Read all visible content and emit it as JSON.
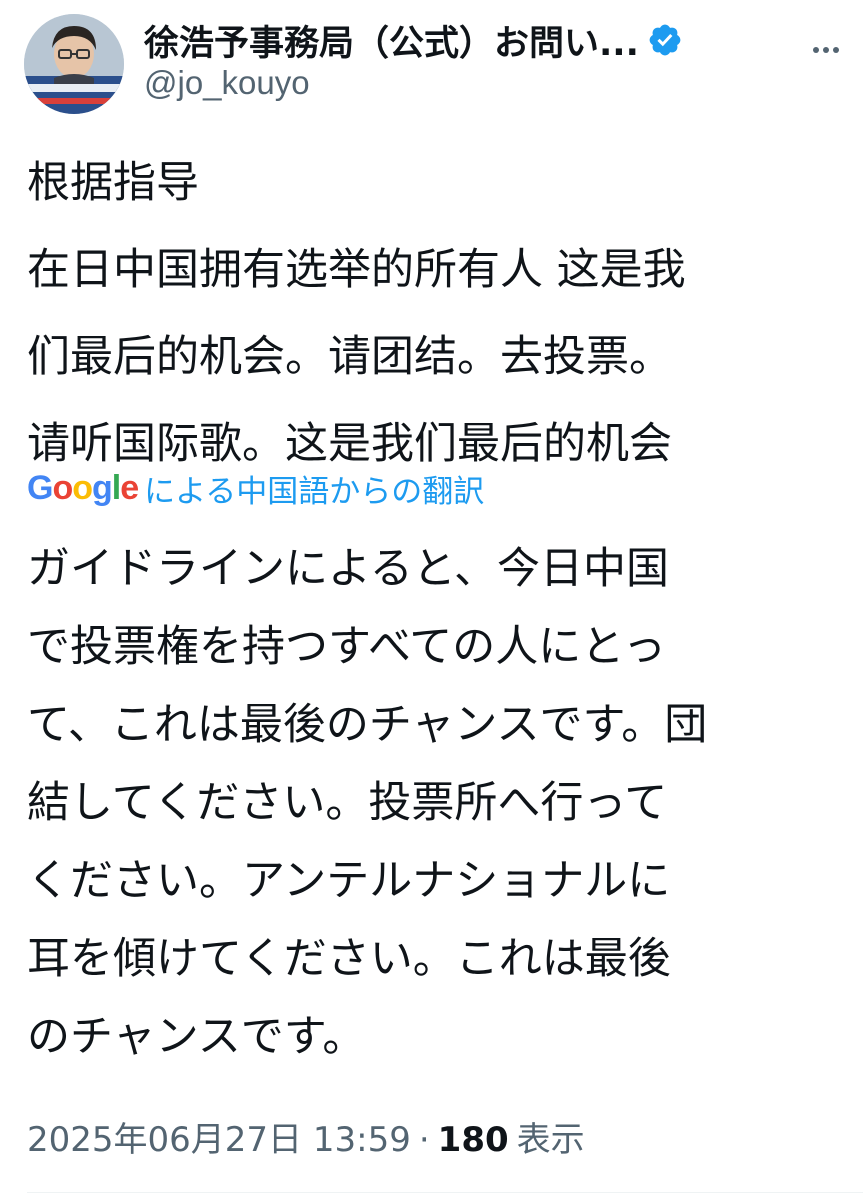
{
  "author": {
    "display_name": "徐浩予事務局（公式）お問い...",
    "handle": "@jo_kouyo",
    "verified": true,
    "verified_color": "#1d9bf0"
  },
  "tweet": {
    "original_text": "根据指导\n在日中国拥有选举的所有人  这是我\n们最后的机会。请团结。去投票。\n请听国际歌。这是我们最后的机会",
    "translation_label": {
      "google": [
        "G",
        "o",
        "o",
        "g",
        "l",
        "e"
      ],
      "note": "による中国語からの翻訳"
    },
    "translated_text": "ガイドラインによると、今日中国\nで投票権を持つすべての人にとっ\nて、これは最後のチャンスです。団\n結してください。投票所へ行って\nください。アンテルナショナルに\n耳を傾けてください。これは最後\nのチャンスです。"
  },
  "meta": {
    "timestamp": "2025年06月27日 13:59",
    "separator": "·",
    "views_count": "180",
    "views_label": "表示"
  },
  "colors": {
    "text": "#0f1419",
    "secondary": "#536471",
    "link": "#1d9bf0"
  },
  "icons": {
    "verified": "verified-badge-icon",
    "more": "more-options-icon"
  }
}
